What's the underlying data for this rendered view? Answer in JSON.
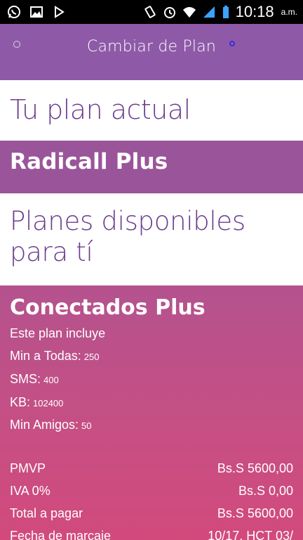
{
  "status_bar": {
    "time": "10:18",
    "ampm": "a.m.",
    "icons": [
      "whatsapp-icon",
      "gallery-icon",
      "play-store-icon",
      "vibrate-icon",
      "alarm-icon",
      "wifi-icon",
      "signal-icon",
      "battery-icon"
    ]
  },
  "header": {
    "title": "Cambiar de Plan"
  },
  "current_plan": {
    "heading": "Tu plan actual",
    "name": "Radicall Plus"
  },
  "available_plans": {
    "heading": "Planes disponibles para tí"
  },
  "plan": {
    "name": "Conectados Plus",
    "includes_label": "Este plan incluye",
    "features": [
      {
        "label": "Min a Todas:",
        "value": "250"
      },
      {
        "label": "SMS:",
        "value": "400"
      },
      {
        "label": "KB:",
        "value": "102400"
      },
      {
        "label": "Min Amigos:",
        "value": "50"
      }
    ],
    "prices": [
      {
        "label": "PMVP",
        "value": "Bs.S 5600,00"
      },
      {
        "label": "IVA 0%",
        "value": "Bs.S 0,00"
      },
      {
        "label": "Total a pagar",
        "value": "Bs.S 5600,00"
      },
      {
        "label": "Fecha de marcaje",
        "value": "10/17. HCT 03/"
      }
    ]
  },
  "colors": {
    "header": "#8e5aa8",
    "heading_text": "#6a3c8e",
    "current_plan_band": "#9a559a",
    "card_top": "#b4528e",
    "card_bottom": "#d24a7c"
  }
}
